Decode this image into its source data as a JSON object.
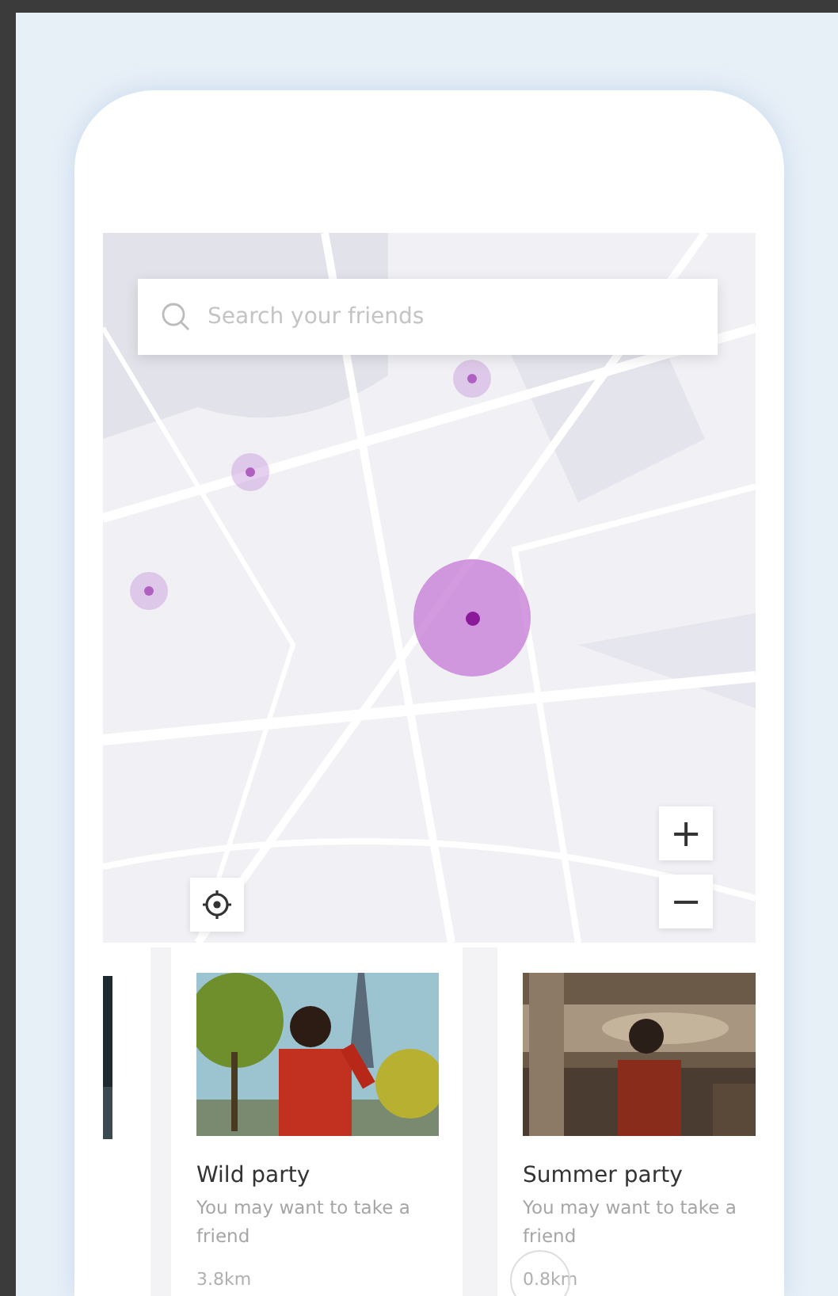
{
  "search": {
    "placeholder": "Search your friends"
  },
  "markers": [
    {
      "selected": false
    },
    {
      "selected": false
    },
    {
      "selected": false
    },
    {
      "selected": true
    }
  ],
  "zoom_controls": {
    "zoom_in": "+",
    "zoom_out": "−"
  },
  "cards": [
    {
      "kind": "partial"
    },
    {
      "kind": "full",
      "title": "Wild party",
      "subtitle": "You may want to take a friend",
      "distance": "3.8km"
    },
    {
      "kind": "full",
      "title": "Summer party",
      "subtitle": "You may want to take a friend",
      "distance": "0.8km",
      "touched": true
    }
  ]
}
